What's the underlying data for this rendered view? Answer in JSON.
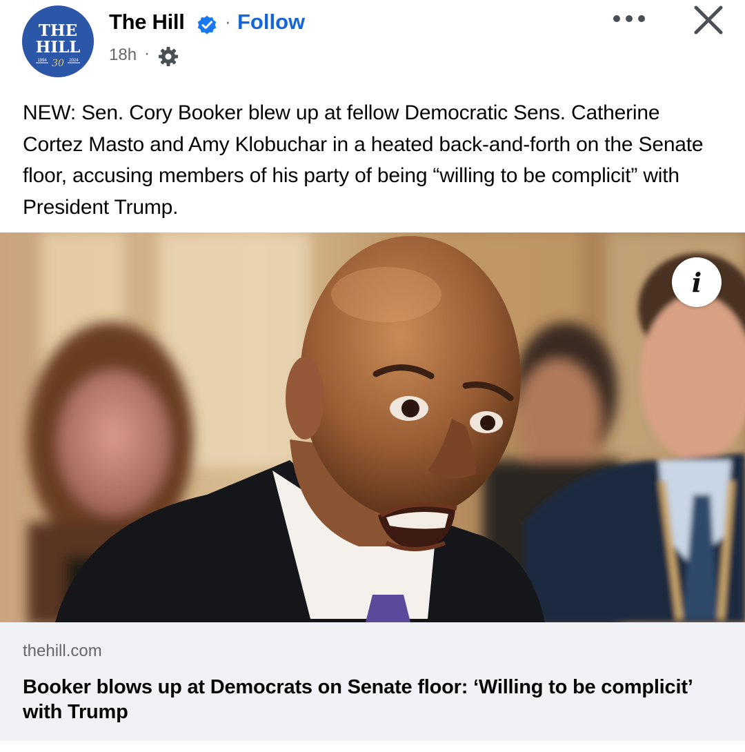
{
  "post": {
    "author": {
      "name": "The Hill",
      "avatar_text_top": "THE",
      "avatar_text_bottom": "HILL",
      "avatar_years": "30",
      "avatar_left_year": "1994",
      "avatar_right_year": "2024",
      "verified": true,
      "verified_icon": "verified-badge-icon"
    },
    "separator": "·",
    "follow_label": "Follow",
    "timestamp": "18h",
    "audience_icon": "gear-icon",
    "more_icon": "more-dots-icon",
    "close_icon": "close-icon",
    "text": "NEW: Sen. Cory Booker blew up at fellow Democratic Sens. Catherine Cortez Masto and Amy Klobuchar in a heated back-and-forth on the Senate floor, accusing members of his party of being “willing to be complicit” with President Trump."
  },
  "photo": {
    "info_label": "i",
    "info_icon": "info-icon"
  },
  "link": {
    "domain": "thehill.com",
    "headline": "Booker blows up at Democrats on Senate floor: ‘Willing to be complicit’ with Trump"
  },
  "colors": {
    "follow": "#1565d8",
    "verified": "#1877f2",
    "avatar_bg": "#2c56a8",
    "card_bg": "#f0f2f5",
    "secondary_text": "#65676b"
  }
}
